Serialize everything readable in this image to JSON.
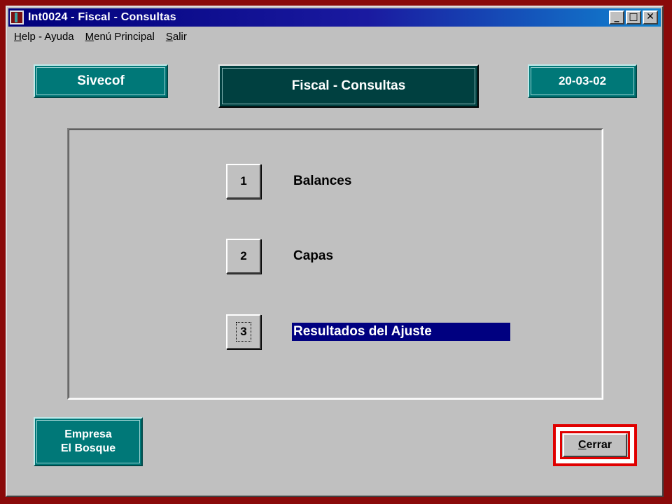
{
  "window": {
    "title": "Int0024 - Fiscal - Consultas",
    "controls": {
      "minimize": "_",
      "maximize": "□",
      "close": "✕"
    }
  },
  "menu": {
    "items": [
      {
        "hotkey": "H",
        "rest": "elp - Ayuda"
      },
      {
        "hotkey": "M",
        "rest": "enú Principal"
      },
      {
        "hotkey": "S",
        "rest": "alir"
      }
    ]
  },
  "header": {
    "system_name": "Sivecof",
    "screen_title": "Fiscal - Consultas",
    "date": "20-03-02"
  },
  "options": [
    {
      "number": "1",
      "label": "Balances"
    },
    {
      "number": "2",
      "label": "Capas"
    },
    {
      "number": "3",
      "label": "Resultados del Ajuste"
    }
  ],
  "company": {
    "line1": "Empresa",
    "line2": "El Bosque"
  },
  "close_button": {
    "hotkey": "C",
    "rest": "errar"
  },
  "colors": {
    "title_gradient_start": "#00007b",
    "teal": "#007878",
    "title_box": "#004040",
    "selection": "#000080",
    "close_frame": "#e00000"
  }
}
